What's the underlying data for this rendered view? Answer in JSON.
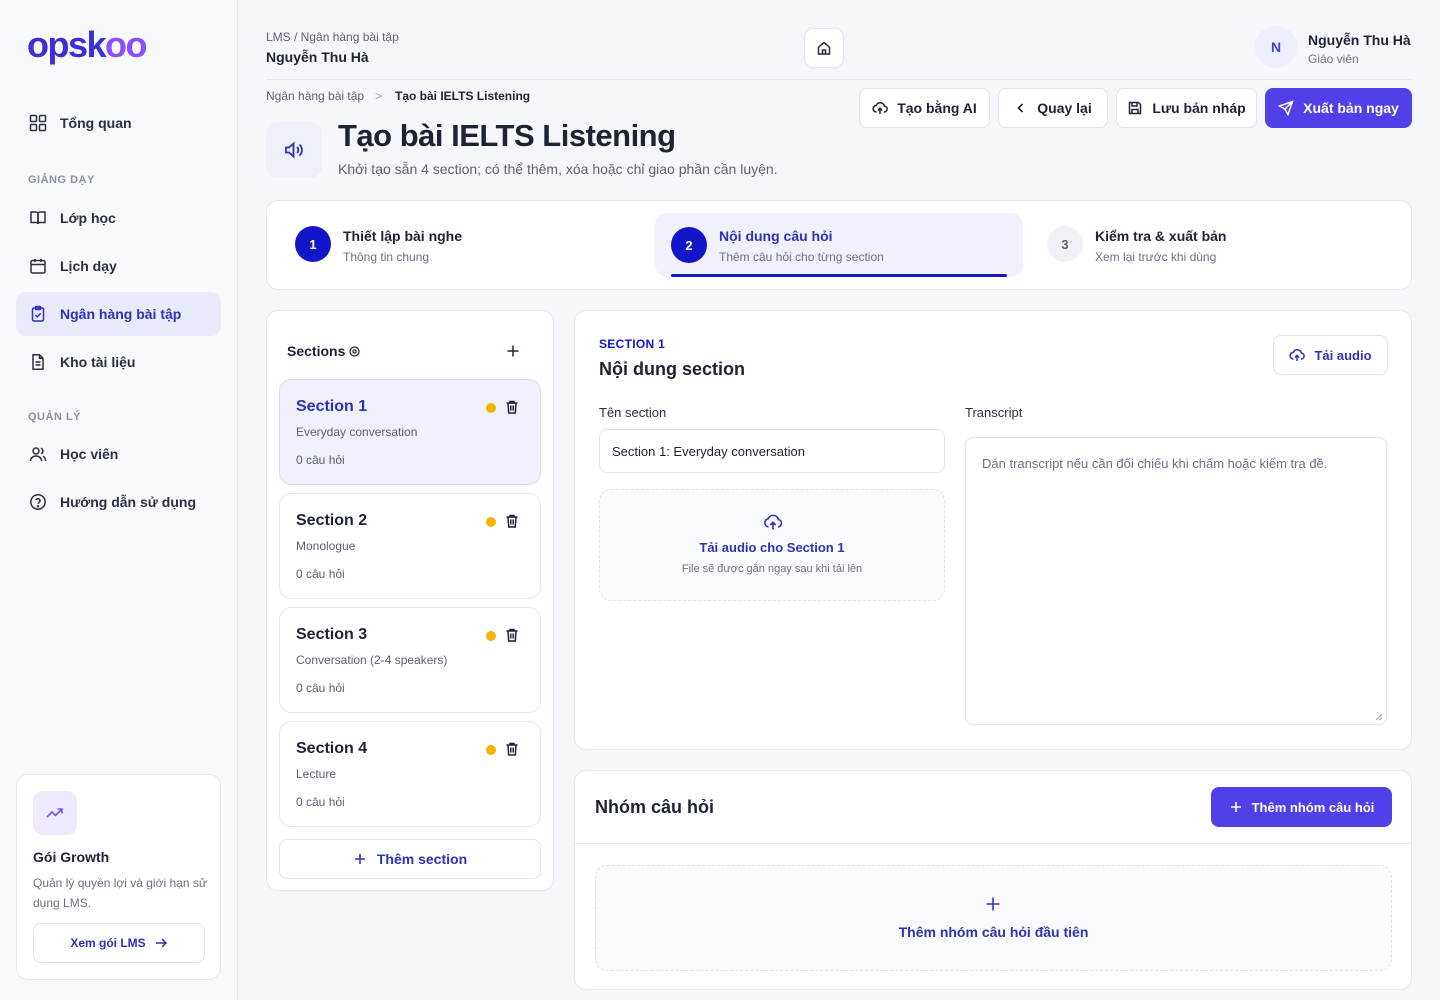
{
  "brand": {
    "logo_text_a": "opsk",
    "logo_text_b": "oo"
  },
  "sidebar": {
    "overview": "Tổng quan",
    "section_teaching": "GIẢNG DẠY",
    "classes": "Lớp học",
    "schedule": "Lịch dạy",
    "exercise_bank": "Ngân hàng bài tập",
    "documents": "Kho tài liệu",
    "section_manage": "QUẢN LÝ",
    "students": "Học viên",
    "guide": "Hướng dẫn sử dụng",
    "plan": {
      "title": "Gói Growth",
      "desc": "Quản lý quyền lợi và giới hạn sử dụng LMS.",
      "button": "Xem gói LMS"
    }
  },
  "header": {
    "breadcrumb": "LMS / Ngân hàng bài tập",
    "user_name_left": "Nguyễn Thu Hà",
    "avatar_initial": "N",
    "user_name": "Nguyễn Thu Hà",
    "user_role": "Giáo viên"
  },
  "page": {
    "crumb_parent": "Ngân hàng bài tập",
    "crumb_sep": ">",
    "crumb_current": "Tạo bài IELTS Listening",
    "title": "Tạo bài IELTS Listening",
    "subtitle": "Khởi tạo sẵn 4 section; có thể thêm, xóa hoặc chỉ giao phần cần luyện.",
    "actions": {
      "ai": "Tạo bằng AI",
      "back": "Quay lại",
      "draft": "Lưu bản nháp",
      "publish": "Xuất bản ngay"
    }
  },
  "stepper": [
    {
      "num": "1",
      "title": "Thiết lập bài nghe",
      "sub": "Thông tin chung"
    },
    {
      "num": "2",
      "title": "Nội dung câu hỏi",
      "sub": "Thêm câu hỏi cho từng section"
    },
    {
      "num": "3",
      "title": "Kiểm tra & xuất bản",
      "sub": "Xem lại trước khi dùng"
    }
  ],
  "sections_panel": {
    "title": "Sections",
    "add_label": "Thêm section",
    "items": [
      {
        "title": "Section 1",
        "sub": "Everyday conversation",
        "count": "0 câu hỏi"
      },
      {
        "title": "Section 2",
        "sub": "Monologue",
        "count": "0 câu hỏi"
      },
      {
        "title": "Section 3",
        "sub": "Conversation (2-4 speakers)",
        "count": "0 câu hỏi"
      },
      {
        "title": "Section 4",
        "sub": "Lecture",
        "count": "0 câu hỏi"
      }
    ]
  },
  "section_content": {
    "eyebrow": "SECTION 1",
    "title": "Nội dung section",
    "upload_btn": "Tải audio",
    "name_label": "Tên section",
    "name_value": "Section 1: Everyday conversation",
    "upload_title": "Tải audio cho Section 1",
    "upload_sub": "File sẽ được gắn ngay sau khi tải lên",
    "transcript_label": "Transcript",
    "transcript_placeholder": "Dán transcript nếu cần đối chiếu khi chấm hoặc kiểm tra đề."
  },
  "question_groups": {
    "title": "Nhóm câu hỏi",
    "add_btn": "Thêm nhóm câu hỏi",
    "empty_text": "Thêm nhóm câu hỏi đầu tiên"
  },
  "colors": {
    "primary": "#5140e8",
    "navy": "#1216c8",
    "accent_text": "#2c34b5",
    "warning": "#f6b400"
  }
}
